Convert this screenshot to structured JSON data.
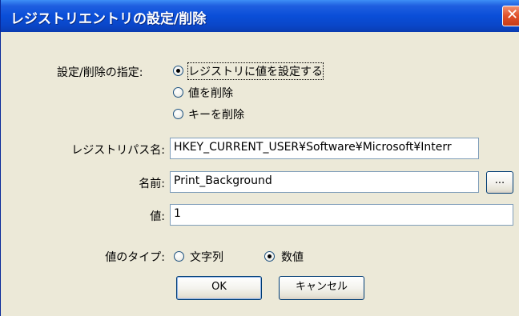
{
  "window": {
    "title": "レジストリエントリの設定/削除",
    "close_glyph": "✕"
  },
  "mode": {
    "label": "設定/削除の指定:",
    "options": [
      {
        "label": "レジストリに値を設定する",
        "selected": true
      },
      {
        "label": "値を削除",
        "selected": false
      },
      {
        "label": "キーを削除",
        "selected": false
      }
    ]
  },
  "registry_path": {
    "label": "レジストリパス名:",
    "value": "HKEY_CURRENT_USER¥Software¥Microsoft¥Interr"
  },
  "name": {
    "label": "名前:",
    "value": "Print_Background",
    "browse_label": "..."
  },
  "value": {
    "label": "値:",
    "value": "1"
  },
  "value_type": {
    "label": "値のタイプ:",
    "options": [
      {
        "label": "文字列",
        "selected": false
      },
      {
        "label": "数値",
        "selected": true
      }
    ]
  },
  "buttons": {
    "ok": "OK",
    "cancel": "キャンセル"
  }
}
